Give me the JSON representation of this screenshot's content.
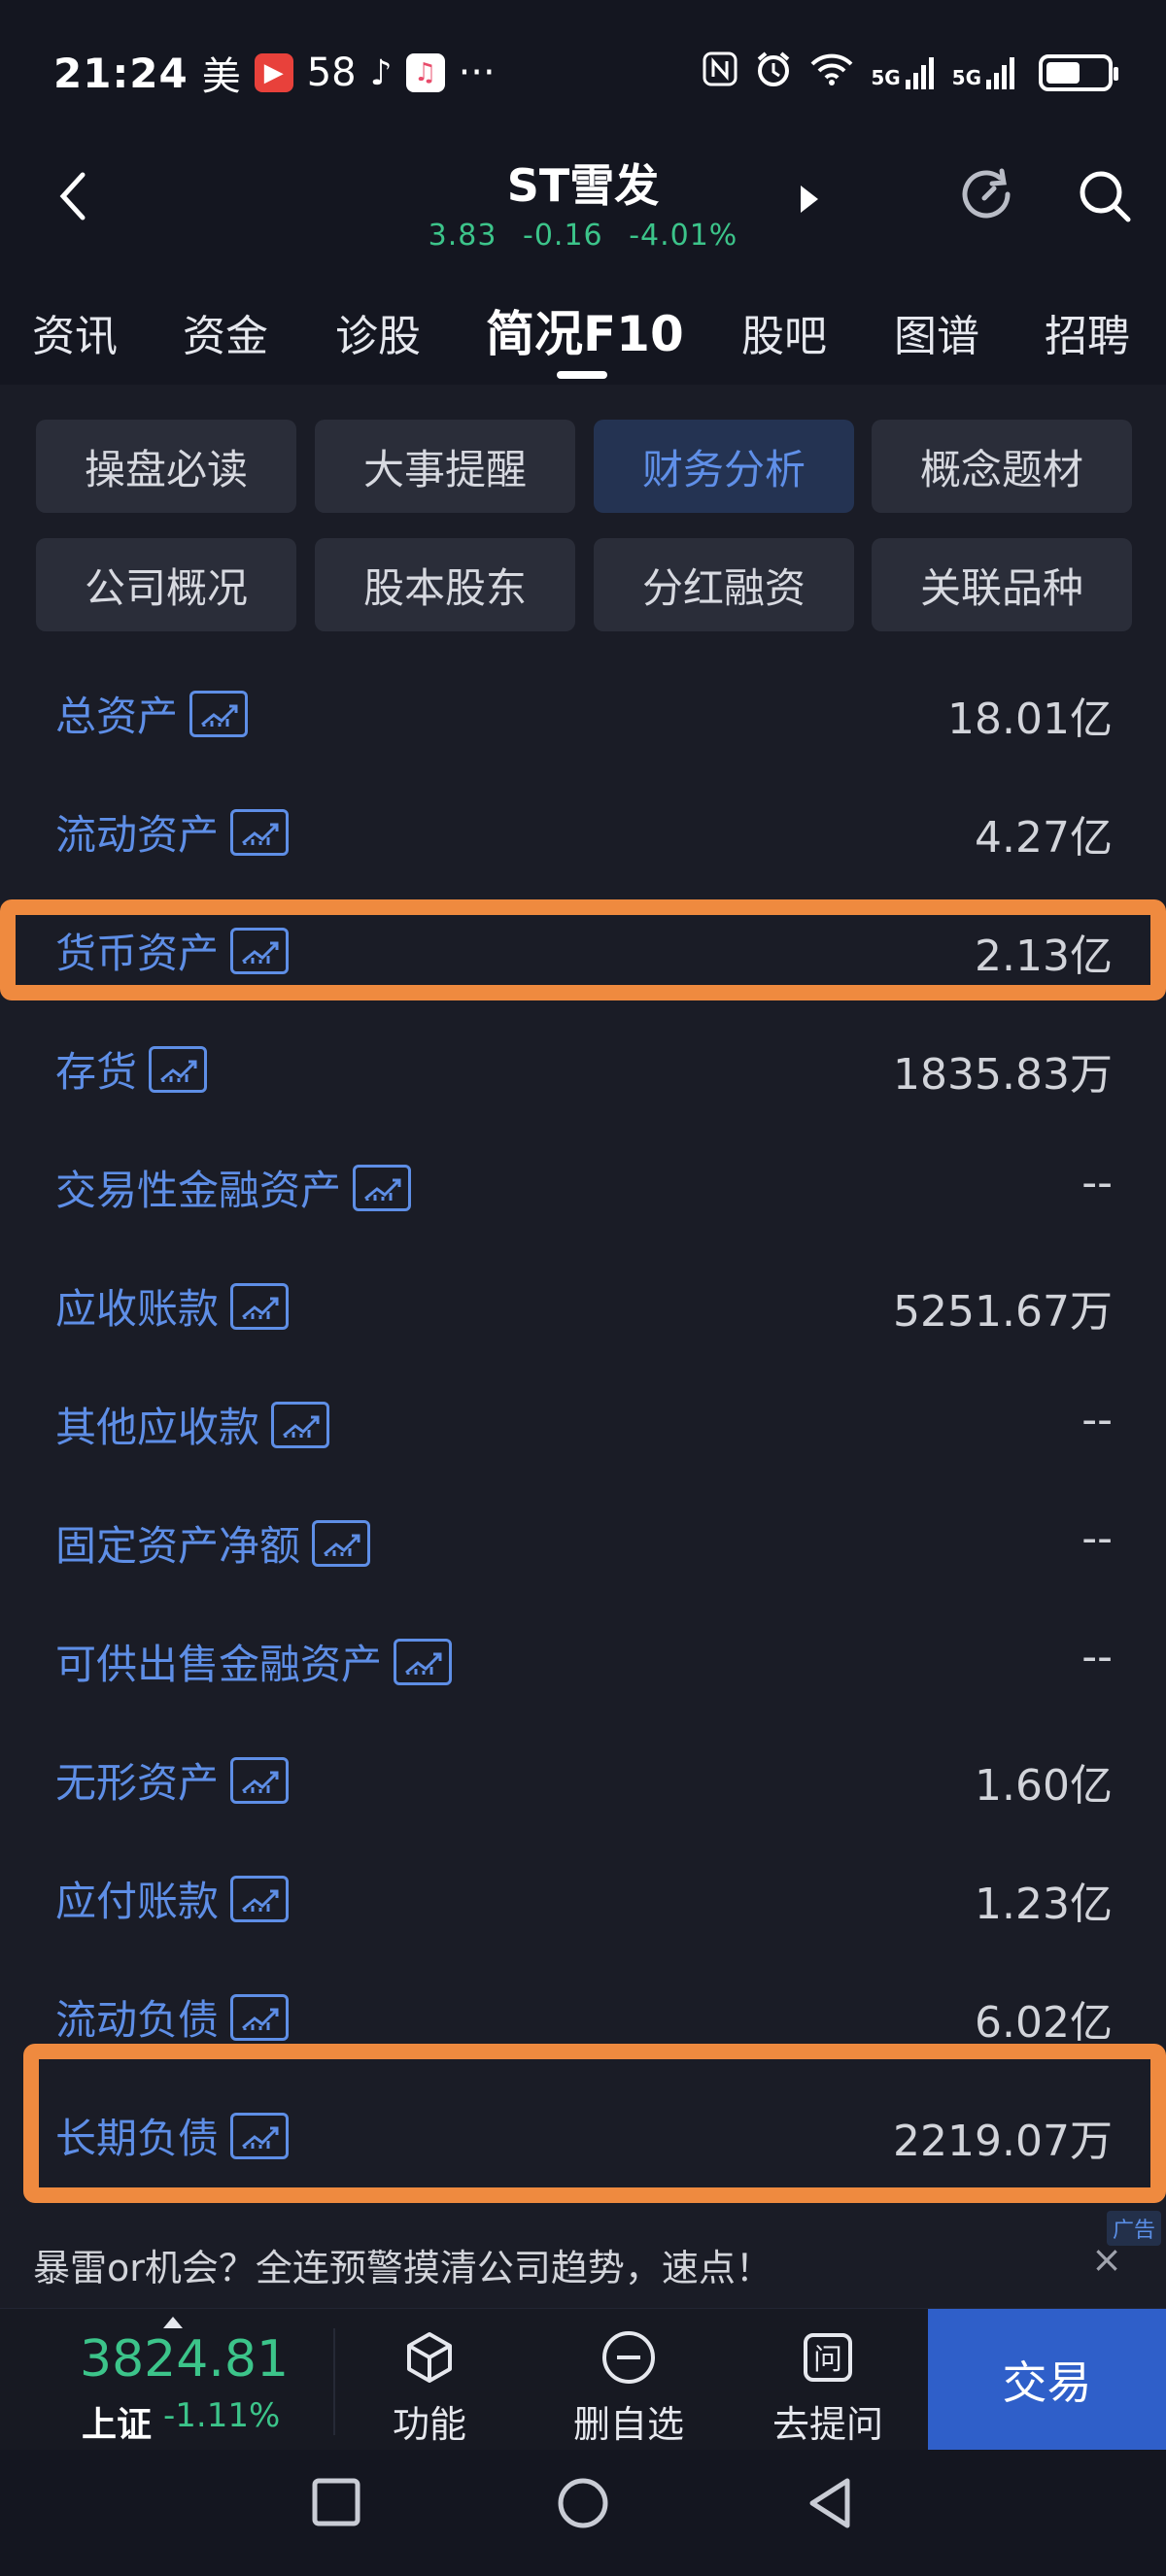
{
  "status_bar": {
    "time": "21:24",
    "app_icons": [
      "美",
      "58"
    ],
    "more": "···",
    "network": "5G"
  },
  "header": {
    "title": "ST雪发",
    "price": "3.83",
    "change": "-0.16",
    "change_pct": "-4.01%",
    "quote_color": "#3cc48a"
  },
  "tabs": [
    {
      "label": "资讯",
      "active": false
    },
    {
      "label": "资金",
      "active": false
    },
    {
      "label": "诊股",
      "active": false
    },
    {
      "label": "简况F10",
      "active": true
    },
    {
      "label": "股吧",
      "active": false
    },
    {
      "label": "图谱",
      "active": false
    },
    {
      "label": "招聘",
      "active": false
    }
  ],
  "subtabs": [
    {
      "label": "操盘必读",
      "active": false
    },
    {
      "label": "大事提醒",
      "active": false
    },
    {
      "label": "财务分析",
      "active": true
    },
    {
      "label": "概念题材",
      "active": false
    },
    {
      "label": "公司概况",
      "active": false
    },
    {
      "label": "股本股东",
      "active": false
    },
    {
      "label": "分红融资",
      "active": false
    },
    {
      "label": "关联品种",
      "active": false
    }
  ],
  "rows": [
    {
      "label": "总资产",
      "value": "18.01亿"
    },
    {
      "label": "流动资产",
      "value": "4.27亿"
    },
    {
      "label": "货币资产",
      "value": "2.13亿"
    },
    {
      "label": "存货",
      "value": "1835.83万"
    },
    {
      "label": "交易性金融资产",
      "value": "--"
    },
    {
      "label": "应收账款",
      "value": "5251.67万"
    },
    {
      "label": "其他应收款",
      "value": "--"
    },
    {
      "label": "固定资产净额",
      "value": "--"
    },
    {
      "label": "可供出售金融资产",
      "value": "--"
    },
    {
      "label": "无形资产",
      "value": "1.60亿"
    },
    {
      "label": "应付账款",
      "value": "1.23亿"
    },
    {
      "label": "流动负债",
      "value": "6.02亿"
    },
    {
      "label": "长期负债",
      "value": "2219.07万"
    }
  ],
  "highlight_color": "#ef8a3f",
  "ad": {
    "text": "暴雷or机会？全连预警摸清公司趋势，速点！",
    "badge": "广告",
    "close": "×"
  },
  "bottom_bar": {
    "index_value": "3824.81",
    "index_name": "上证",
    "index_pct": "-1.11%",
    "func_label": "功能",
    "remove_label": "删自选",
    "ask_label": "去提问",
    "trade_label": "交易"
  }
}
